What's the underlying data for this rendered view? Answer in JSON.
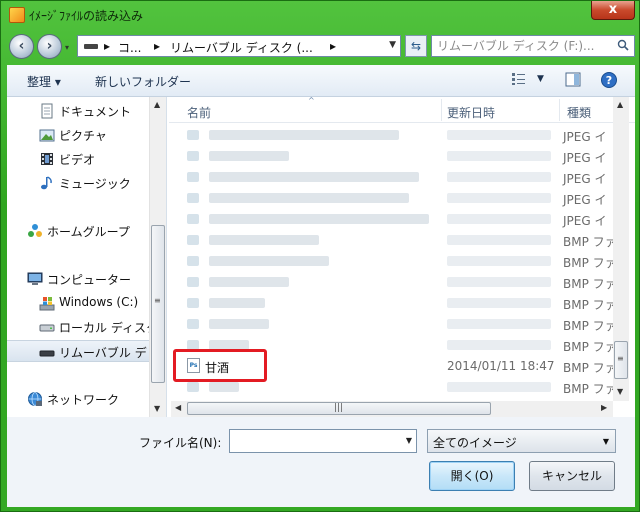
{
  "window": {
    "title": "ｲﾒｰｼﾞﾌｧｲﾙの読み込み",
    "close_glyph": "x"
  },
  "address_bar": {
    "segments": [
      "コ...",
      "リムーバブル ディスク (..."
    ],
    "separator": "▸"
  },
  "search": {
    "placeholder": "リムーバブル ディスク (F:)..."
  },
  "toolbar": {
    "organize_label": "整理 ▾",
    "new_folder_label": "新しいフォルダー"
  },
  "nav_pane": {
    "items": [
      {
        "label": "ドキュメント",
        "icon": "document-icon"
      },
      {
        "label": "ピクチャ",
        "icon": "pictures-icon"
      },
      {
        "label": "ビデオ",
        "icon": "video-icon"
      },
      {
        "label": "ミュージック",
        "icon": "music-icon"
      },
      {
        "label": "ホームグループ",
        "icon": "homegroup-icon"
      },
      {
        "label": "コンピューター",
        "icon": "computer-icon"
      },
      {
        "label": "Windows (C:)",
        "icon": "windows-drive-icon"
      },
      {
        "label": "ローカル ディスク",
        "icon": "local-disk-icon"
      },
      {
        "label": "リムーバブル デ",
        "icon": "removable-drive-icon"
      },
      {
        "label": "ネットワーク",
        "icon": "network-icon"
      }
    ]
  },
  "file_list": {
    "columns": {
      "name": "名前",
      "date": "更新日時",
      "type": "種類"
    },
    "type_cells": [
      "JPEG イ",
      "JPEG イ",
      "JPEG イ",
      "JPEG イ",
      "JPEG イ",
      "BMP ファ",
      "BMP ファ",
      "BMP ファ",
      "BMP ファ",
      "BMP ファ",
      "BMP ファ",
      "BMP ファ",
      "BMP ファ"
    ],
    "highlighted_file": {
      "name": "甘酒",
      "date": "2014/01/11 18:47",
      "icon_text": "Ps"
    }
  },
  "bottom": {
    "filename_label": "ファイル名(N):",
    "filename_value": "",
    "filetype_value": "全てのイメージ",
    "open_label": "開く(O)",
    "cancel_label": "キャンセル"
  },
  "colors": {
    "frame": "#34a824",
    "highlight": "#e31b23"
  }
}
